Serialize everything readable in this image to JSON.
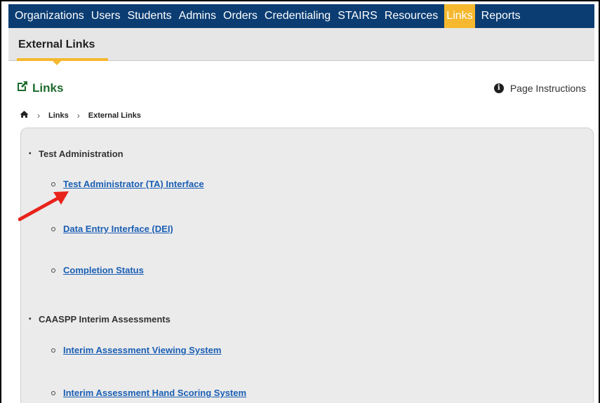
{
  "nav": {
    "items": [
      {
        "label": "Organizations"
      },
      {
        "label": "Users"
      },
      {
        "label": "Students"
      },
      {
        "label": "Admins"
      },
      {
        "label": "Orders"
      },
      {
        "label": "Credentialing"
      },
      {
        "label": "STAIRS"
      },
      {
        "label": "Resources"
      },
      {
        "label": "Links",
        "active": true
      },
      {
        "label": "Reports"
      }
    ]
  },
  "subnav": {
    "tab_label": "External Links"
  },
  "page": {
    "title": "Links",
    "instructions_label": "Page Instructions",
    "instructions_icon": "info-icon",
    "title_icon": "external-link-icon"
  },
  "breadcrumb": {
    "home_icon": "home-icon",
    "items": [
      {
        "label": "Links"
      },
      {
        "label": "External Links"
      }
    ]
  },
  "sections": [
    {
      "label": "Test Administration",
      "links": [
        {
          "label": "Test Administrator (TA) Interface"
        },
        {
          "label": "Data Entry Interface (DEI)"
        },
        {
          "label": "Completion Status"
        }
      ]
    },
    {
      "label": "CAASPP Interim Assessments",
      "links": [
        {
          "label": "Interim Assessment Viewing System"
        },
        {
          "label": "Interim Assessment Hand Scoring System"
        }
      ]
    }
  ],
  "colors": {
    "nav_bg": "#0b3d73",
    "accent": "#f5b82e",
    "title_green": "#1e6b2c",
    "link_blue": "#1b5fb4",
    "annotation_arrow": "#e8231c"
  }
}
